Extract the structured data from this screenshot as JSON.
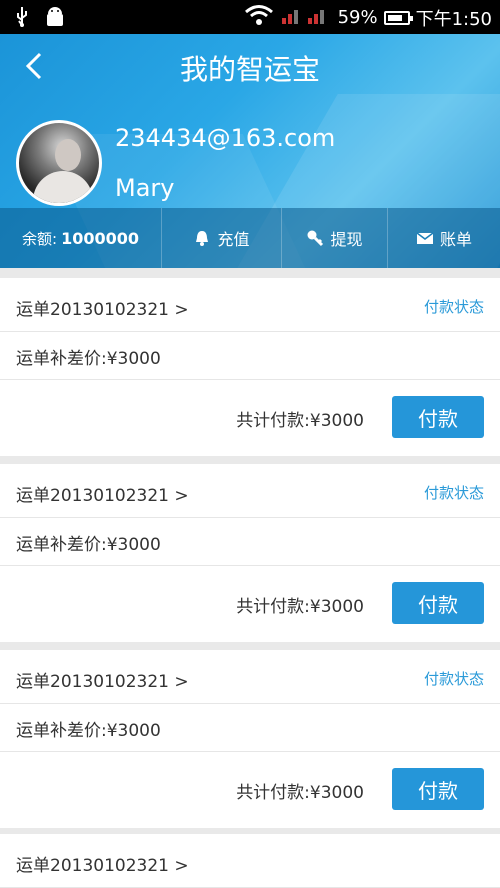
{
  "status_bar": {
    "usb_icon": "usb-icon",
    "android_icon": "android-debug-icon",
    "wifi_icon": "wifi-icon",
    "signal_icon": "signal-icon",
    "battery_percent": "59%",
    "battery_icon": "battery-charging-icon",
    "time": "下午1:50"
  },
  "header": {
    "back_icon": "chevron-left-icon",
    "title": "我的智运宝",
    "email": "234434@163.com",
    "name": "Mary",
    "actions": {
      "balance_label": "余额:",
      "balance_value": "1000000",
      "recharge_label": "充值",
      "recharge_icon": "bell-icon",
      "withdraw_label": "提现",
      "withdraw_icon": "key-icon",
      "bill_label": "账单",
      "bill_icon": "envelope-icon"
    }
  },
  "orders": [
    {
      "order_no": "运单20130102321 >",
      "status": "付款状态",
      "diff_price": "运单补差价:¥3000",
      "total": "共计付款:¥3000",
      "pay_label": "付款"
    },
    {
      "order_no": "运单20130102321 >",
      "status": "付款状态",
      "diff_price": "运单补差价:¥3000",
      "total": "共计付款:¥3000",
      "pay_label": "付款"
    },
    {
      "order_no": "运单20130102321 >",
      "status": "付款状态",
      "diff_price": "运单补差价:¥3000",
      "total": "共计付款:¥3000",
      "pay_label": "付款"
    },
    {
      "order_no": "运单20130102321 >"
    }
  ],
  "colors": {
    "accent": "#2596d9",
    "status_text": "#2a9ad8"
  }
}
